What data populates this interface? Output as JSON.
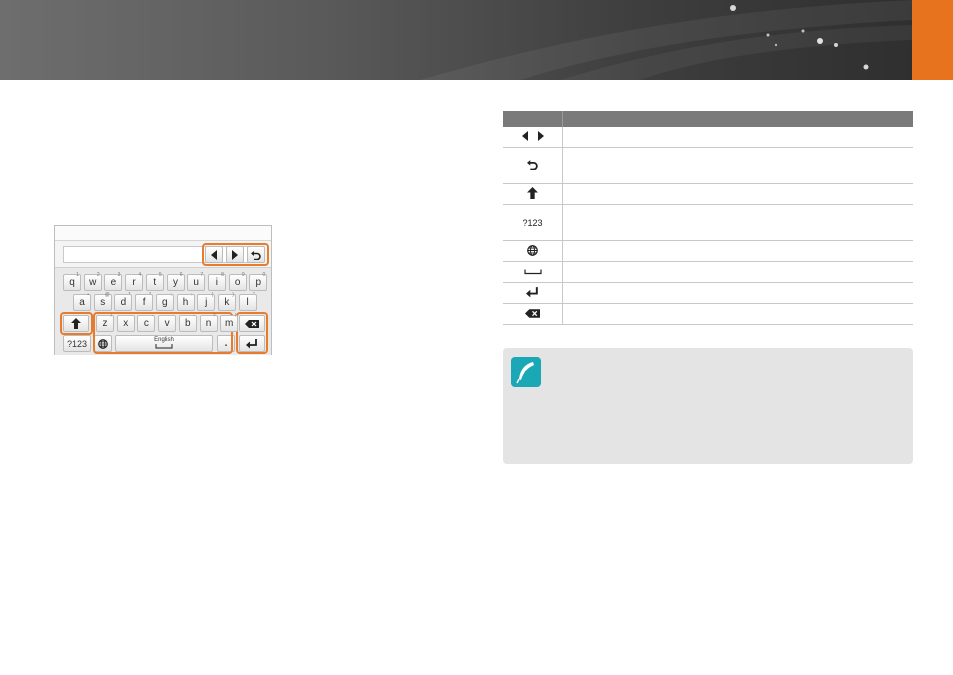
{
  "keyboard": {
    "row1": [
      {
        "k": "q",
        "s": "1"
      },
      {
        "k": "w",
        "s": "2"
      },
      {
        "k": "e",
        "s": "3"
      },
      {
        "k": "r",
        "s": "4"
      },
      {
        "k": "t",
        "s": "5"
      },
      {
        "k": "y",
        "s": "6"
      },
      {
        "k": "u",
        "s": "7"
      },
      {
        "k": "i",
        "s": "8"
      },
      {
        "k": "o",
        "s": "9"
      },
      {
        "k": "p",
        "s": "0"
      }
    ],
    "row2": [
      {
        "k": "a",
        "s": "•"
      },
      {
        "k": "s",
        "s": "@"
      },
      {
        "k": "d",
        "s": "*"
      },
      {
        "k": "f",
        "s": "*"
      },
      {
        "k": "g",
        "s": ":"
      },
      {
        "k": "h",
        "s": ":"
      },
      {
        "k": "j",
        "s": "("
      },
      {
        "k": "k",
        "s": ")"
      },
      {
        "k": "l",
        "s": "\""
      }
    ],
    "row3": [
      {
        "k": "z",
        "s": "/"
      },
      {
        "k": "x",
        "s": ""
      },
      {
        "k": "c",
        "s": "-"
      },
      {
        "k": "v",
        "s": ""
      },
      {
        "k": "b",
        "s": "-"
      },
      {
        "k": "n",
        "s": "?"
      },
      {
        "k": "m",
        "s": "!"
      }
    ],
    "sym_key": "?123",
    "space_label": "English",
    "period_key": "."
  },
  "table": {
    "rows": [
      {
        "icon": "arrows-icon"
      },
      {
        "icon": "undo-icon",
        "tall": true
      },
      {
        "icon": "shift-icon"
      },
      {
        "icon_text": "?123",
        "tall": true
      },
      {
        "icon": "globe-icon"
      },
      {
        "icon": "space-icon"
      },
      {
        "icon": "enter-icon"
      },
      {
        "icon": "backspace-icon"
      }
    ]
  },
  "colors": {
    "accent": "#e8731e",
    "note_icon": "#1aa8b6",
    "highlight": "#e87c2c"
  }
}
